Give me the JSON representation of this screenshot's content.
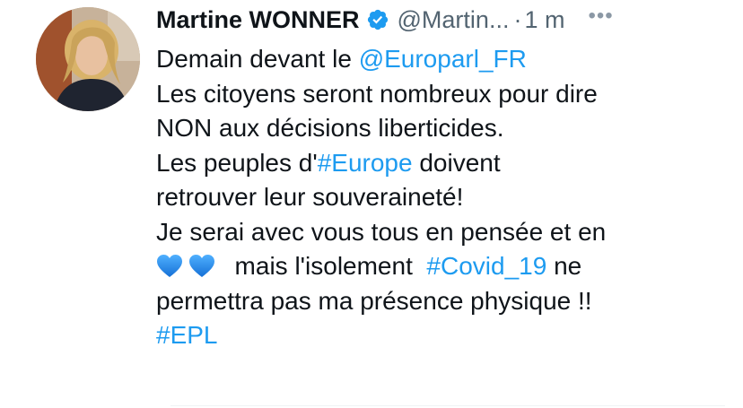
{
  "author": {
    "name": "Martine WONNER",
    "handle": "@Martin...",
    "separator": "·",
    "time": "1 m",
    "more_label": "•••"
  },
  "tweet": {
    "lines": [
      [
        {
          "text": "Demain devant le "
        },
        {
          "text": "@Europarl_FR",
          "link": true
        }
      ],
      [
        {
          "text": "Les citoyens seront nombreux pour dire"
        }
      ],
      [
        {
          "text": "NON aux décisions liberticides."
        }
      ],
      [
        {
          "text": "Les peuples d'"
        },
        {
          "text": "#Europe",
          "link": true
        },
        {
          "text": " doivent"
        }
      ],
      [
        {
          "text": "retrouver leur souveraineté!"
        }
      ],
      [
        {
          "text": "Je serai avec vous tous en pensée et en"
        }
      ],
      [
        {
          "emoji": "blue-heart"
        },
        {
          "emoji": "blue-heart"
        },
        {
          "text": "  mais l'isolement  "
        },
        {
          "text": "#Covid_19",
          "link": true
        },
        {
          "text": " ne"
        }
      ],
      [
        {
          "text": "permettra pas ma présence physique !!"
        }
      ],
      [
        {
          "text": "#EPL",
          "link": true
        }
      ]
    ]
  },
  "colors": {
    "link": "#1d9bf0",
    "text": "#0f1419",
    "muted": "#536471",
    "verified": "#1d9bf0",
    "heart": "#1f8ce9"
  },
  "icons": {
    "verified": "verified-badge-icon",
    "more": "more-options-icon",
    "heart": "blue-heart-icon"
  }
}
